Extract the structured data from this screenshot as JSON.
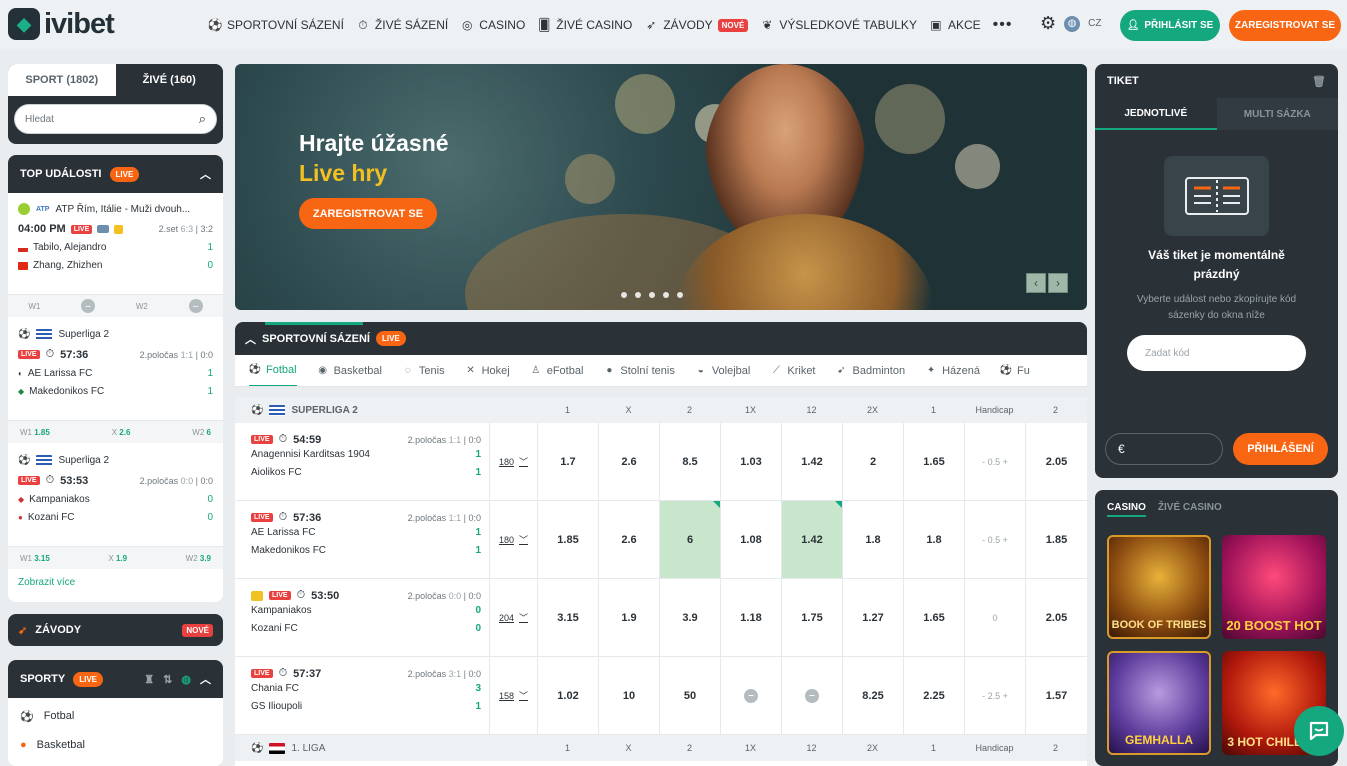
{
  "header": {
    "logo_text": "ivibet",
    "nav": [
      {
        "label": "SPORTOVNÍ SÁZENÍ",
        "icon": "soccer-ball-icon"
      },
      {
        "label": "ŽIVÉ SÁZENÍ",
        "icon": "stopwatch-icon"
      },
      {
        "label": "CASINO",
        "icon": "roulette-icon"
      },
      {
        "label": "ŽIVÉ CASINO",
        "icon": "cards-icon"
      },
      {
        "label": "ZÁVODY",
        "icon": "rocket-icon",
        "badge": "NOVÉ"
      },
      {
        "label": "VÝSLEDKOVÉ TABULKY",
        "icon": "laurel-icon"
      },
      {
        "label": "AKCE",
        "icon": "gift-icon"
      }
    ],
    "more": "•••",
    "lang": "CZ",
    "login_label": "PŘIHLÁSIT SE",
    "register_label": "ZAREGISTROVAT SE"
  },
  "left": {
    "tab_sport": "SPORT (1802)",
    "tab_live": "ŽIVÉ (160)",
    "search_placeholder": "Hledat",
    "top_title": "TOP UDÁLOSTI",
    "live_badge": "LIVE",
    "events": [
      {
        "league": "ATP Řím, Itálie - Muži dvouh...",
        "time": "04:00 PM",
        "live": "LIVE",
        "period": "2.set",
        "score_sets": "6:3",
        "score_cur": "3:2",
        "team1": "Tabilo, Alejandro",
        "team2": "Zhang, Zhizhen",
        "s1": "1",
        "s2": "0",
        "o1l": "W1",
        "o2l": "W2"
      },
      {
        "league": "Superliga 2",
        "time": "57:36",
        "live": "LIVE",
        "period": "2.poločas",
        "score_sets": "1:1",
        "score_cur": "0:0",
        "team1": "AE Larissa FC",
        "team2": "Makedonikos FC",
        "s1": "1",
        "s2": "1",
        "o1l": "W1",
        "o1": "1.85",
        "oxl": "X",
        "ox": "2.6",
        "o2l": "W2",
        "o2": "6"
      },
      {
        "league": "Superliga 2",
        "time": "53:53",
        "live": "LIVE",
        "period": "2.poločas",
        "score_sets": "0:0",
        "score_cur": "0:0",
        "team1": "Kampaniakos",
        "team2": "Kozani FC",
        "s1": "0",
        "s2": "0",
        "o1l": "W1",
        "o1": "3.15",
        "oxl": "X",
        "ox": "1.9",
        "o2l": "W2",
        "o2": "3.9"
      }
    ],
    "show_more": "Zobrazit více",
    "zavody": "ZÁVODY",
    "zavody_badge": "NOVÉ",
    "sporty_title": "SPORTY",
    "sporty_items": [
      "Fotbal",
      "Basketbal"
    ]
  },
  "banner": {
    "line1": "Hrajte úžasné",
    "line2": "Live hry",
    "cta": "ZAREGISTROVAT SE",
    "accent": "#f3c021"
  },
  "betting": {
    "title": "SPORTOVNÍ SÁZENÍ",
    "live_badge": "LIVE",
    "sports": [
      "Fotbal",
      "Basketbal",
      "Tenis",
      "Hokej",
      "eFotbal",
      "Stolní tenis",
      "Volejbal",
      "Kriket",
      "Badminton",
      "Házená",
      "Fu"
    ],
    "columns": [
      "1",
      "X",
      "2",
      "1X",
      "12",
      "2X",
      "1",
      "Handicap",
      "2"
    ],
    "league1": "SUPERLIGA 2",
    "league2": "1. LIGA",
    "matches": [
      {
        "live": "LIVE",
        "time": "54:59",
        "period": "2.poločas",
        "half": "1:1",
        "cur": "0:0",
        "team1": "Anagennisi Karditsas 1904",
        "team2": "Aiolikos FC",
        "s1": "1",
        "s2": "1",
        "count": "180",
        "odds": [
          "1.7",
          "2.6",
          "8.5",
          "1.03",
          "1.42",
          "2",
          "1.65",
          "- 0.5 +",
          "2.05"
        ]
      },
      {
        "live": "LIVE",
        "time": "57:36",
        "period": "2.poločas",
        "half": "1:1",
        "cur": "0:0",
        "team1": "AE Larissa FC",
        "team2": "Makedonikos FC",
        "s1": "1",
        "s2": "1",
        "count": "180",
        "odds": [
          "1.85",
          "2.6",
          "6",
          "1.08",
          "1.42",
          "1.8",
          "1.8",
          "- 0.5 +",
          "1.85"
        ]
      },
      {
        "live": "LIVE",
        "time": "53:50",
        "period": "2.poločas",
        "half": "0:0",
        "cur": "0:0",
        "team1": "Kampaniakos",
        "team2": "Kozani FC",
        "s1": "0",
        "s2": "0",
        "count": "204",
        "odds": [
          "3.15",
          "1.9",
          "3.9",
          "1.18",
          "1.75",
          "1.27",
          "1.65",
          "0",
          "2.05"
        ]
      },
      {
        "live": "LIVE",
        "time": "57:37",
        "period": "2.poločas",
        "half": "3:1",
        "cur": "0:0",
        "team1": "Chania FC",
        "team2": "GS Ilioupoli",
        "s1": "3",
        "s2": "1",
        "count": "158",
        "odds": [
          "1.02",
          "10",
          "50",
          "",
          "",
          "8.25",
          "2.25",
          "- 2.5 +",
          "1.57"
        ]
      }
    ]
  },
  "ticket": {
    "title": "TIKET",
    "tab_single": "JEDNOTLIVÉ",
    "tab_multi": "MULTI SÁZKA",
    "empty_title": "Váš tiket je momentálně prázdný",
    "empty_text": "Vyberte událost nebo zkopírujte kód sázenky do okna níže",
    "code_placeholder": "Zadat kód",
    "currency": "€",
    "login_label": "PŘIHLÁŠENÍ"
  },
  "casino": {
    "tab_casino": "CASINO",
    "tab_live": "ŽIVÉ CASINO",
    "games": [
      "BOOK OF TRIBES",
      "20 BOOST HOT",
      "GEMHALLA",
      "3 HOT CHILLIES"
    ]
  },
  "colors": {
    "green": "#15a77e",
    "orange": "#f86613",
    "dark": "#2a3238"
  }
}
